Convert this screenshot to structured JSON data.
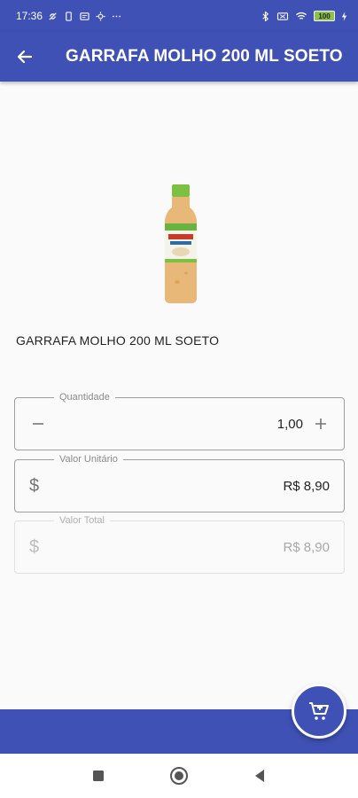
{
  "status_bar": {
    "time": "17:36",
    "battery": "100"
  },
  "app_bar": {
    "title": "GARRAFA MOLHO 200 ML SOETO",
    "back_icon": "arrow-left-icon"
  },
  "product": {
    "name": "GARRAFA MOLHO 200 ML SOETO",
    "image": "sauce-bottle-image"
  },
  "fields": {
    "quantity": {
      "label": "Quantidade",
      "value": "1,00",
      "minus_icon": "minus-icon",
      "plus_icon": "plus-icon"
    },
    "unit_price": {
      "label": "Valor Unitário",
      "prefix": "$",
      "value": "R$ 8,90"
    },
    "total_price": {
      "label": "Valor Total",
      "prefix": "$",
      "value": "R$ 8,90"
    }
  },
  "fab": {
    "icon": "add-to-cart-icon"
  },
  "colors": {
    "primary": "#3f51b5",
    "background": "#fafafa"
  }
}
